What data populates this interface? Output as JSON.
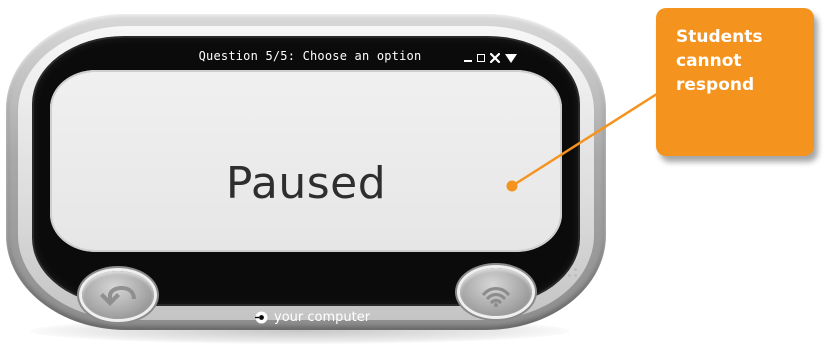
{
  "device": {
    "title": "Question 5/5: Choose an option",
    "status": "Paused",
    "source_label": "your computer",
    "window_controls": {
      "minimize_icon": "minimize-icon",
      "maximize_icon": "maximize-icon",
      "close_icon": "close-icon",
      "menu_icon": "dropdown-triangle-icon"
    },
    "buttons": {
      "back_icon": "back-arrow-icon",
      "wifi_icon": "wifi-icon"
    }
  },
  "callout": {
    "lines": [
      "Students",
      "cannot",
      "respond"
    ],
    "color": "#f5931f"
  },
  "colors": {
    "screen": "#e8e8e8",
    "bezel": "#0b0b0b",
    "callout": "#f5931f",
    "text_dark": "#2e2e2e"
  }
}
